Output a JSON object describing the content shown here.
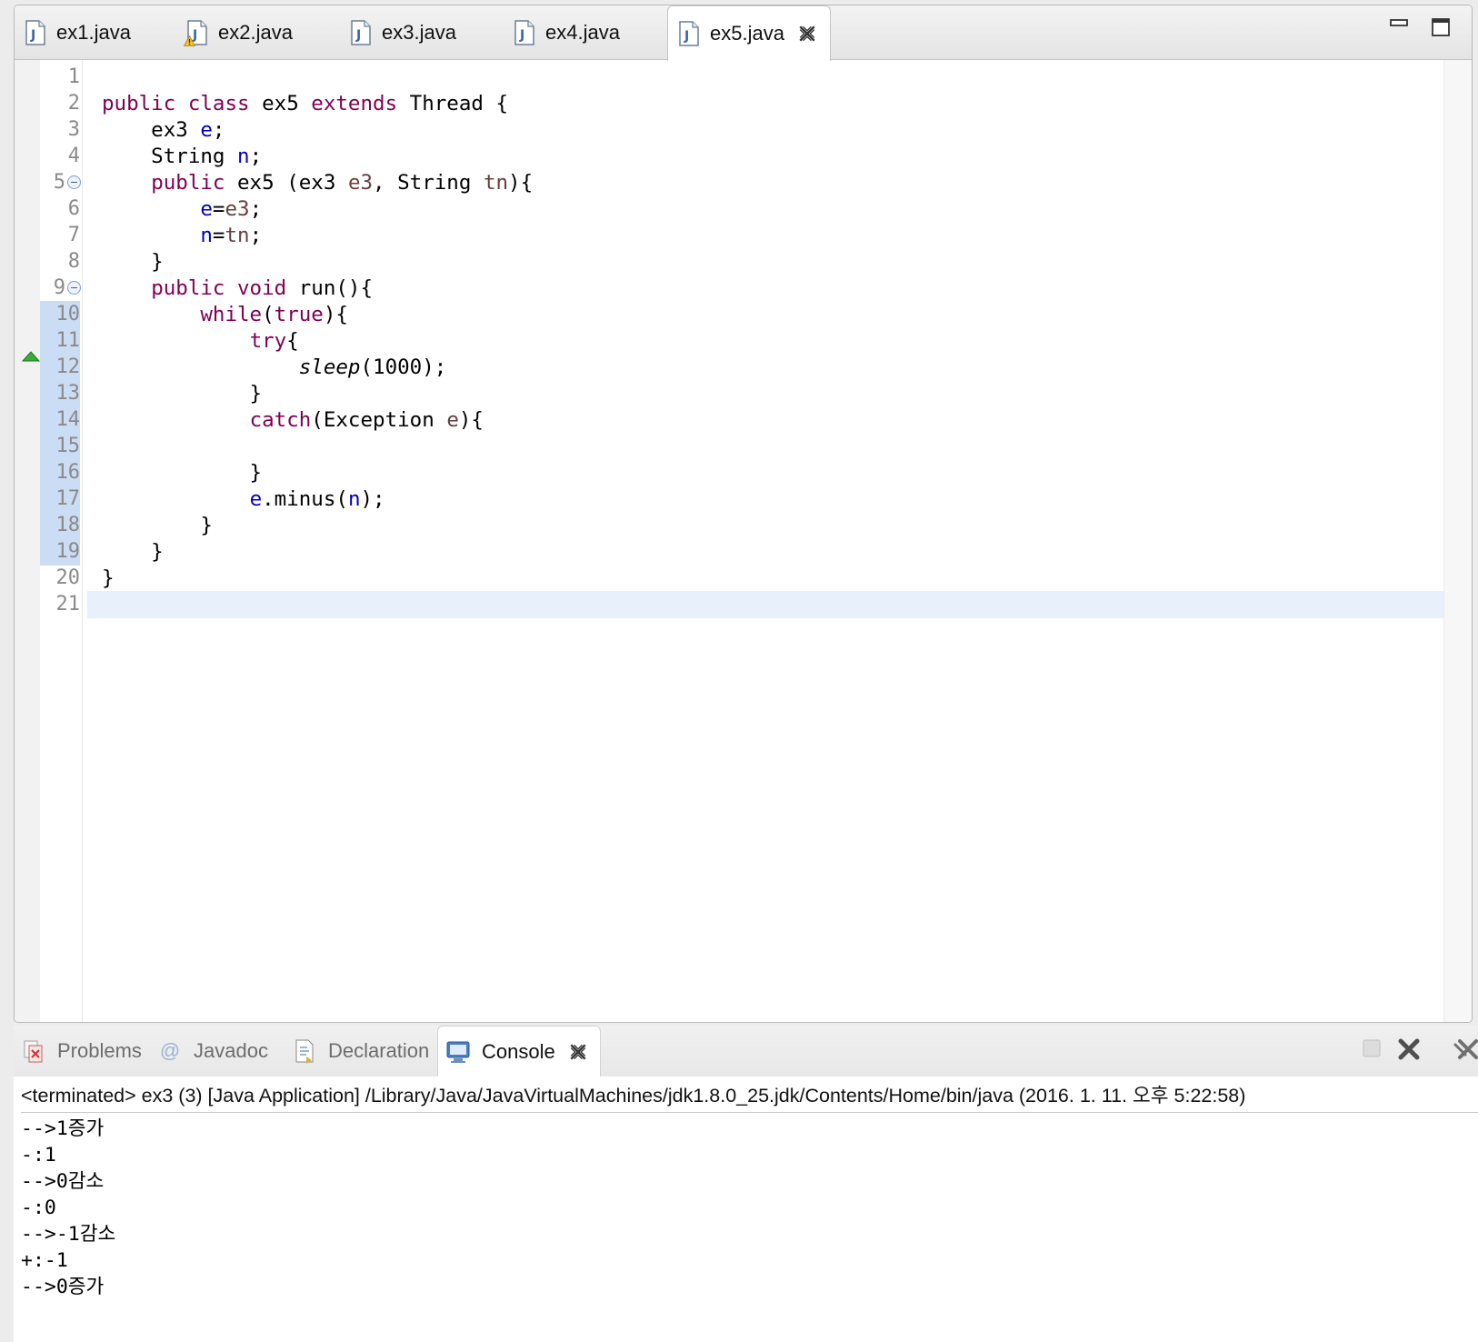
{
  "editor": {
    "tabs": [
      {
        "label": "ex1.java",
        "active": false,
        "warning": false
      },
      {
        "label": "ex2.java",
        "active": false,
        "warning": true
      },
      {
        "label": "ex3.java",
        "active": false,
        "warning": false
      },
      {
        "label": "ex4.java",
        "active": false,
        "warning": false
      },
      {
        "label": "ex5.java",
        "active": true,
        "warning": false
      }
    ],
    "line_numbers": [
      "1",
      "2",
      "3",
      "4",
      "5",
      "6",
      "7",
      "8",
      "9",
      "10",
      "11",
      "12",
      "13",
      "14",
      "15",
      "16",
      "17",
      "18",
      "19",
      "20",
      "21"
    ],
    "folded_lines": [
      "5",
      "9"
    ],
    "selected_range_lines": [
      "10",
      "11",
      "12",
      "13",
      "14",
      "15",
      "16",
      "17",
      "18",
      "19"
    ],
    "current_line": "21",
    "code_lines": [
      "",
      "public class ex5 extends Thread {",
      "    ex3 e;",
      "    String n;",
      "    public ex5 (ex3 e3, String tn){",
      "        e=e3;",
      "        n=tn;",
      "    }",
      "    public void run(){",
      "        while(true){",
      "            try{",
      "                sleep(1000);",
      "            }",
      "            catch(Exception e){",
      "",
      "            }",
      "            e.minus(n);",
      "        }",
      "    }",
      "}",
      ""
    ]
  },
  "bottom_panel": {
    "tabs": [
      {
        "label": "Problems",
        "icon": "problems-icon",
        "active": false
      },
      {
        "label": "Javadoc",
        "icon": "at-sign-icon",
        "active": false
      },
      {
        "label": "Declaration",
        "icon": "declaration-icon",
        "active": false
      },
      {
        "label": "Console",
        "icon": "console-icon",
        "active": true
      }
    ],
    "console_header": "<terminated> ex3 (3) [Java Application] /Library/Java/JavaVirtualMachines/jdk1.8.0_25.jdk/Contents/Home/bin/java (2016. 1. 11. 오후 5:22:58)",
    "console_lines": [
      "-->1증가",
      "-:1",
      "-->0감소",
      "-:0",
      "-->-1감소",
      "+:-1",
      "-->0증가"
    ]
  },
  "colors": {
    "keyword": "#7f0055",
    "field": "#0000c0",
    "local_variable": "#6a3e3e",
    "current_line_highlight": "#e8f1fb",
    "selection_gutter": "#cbdcf5"
  }
}
